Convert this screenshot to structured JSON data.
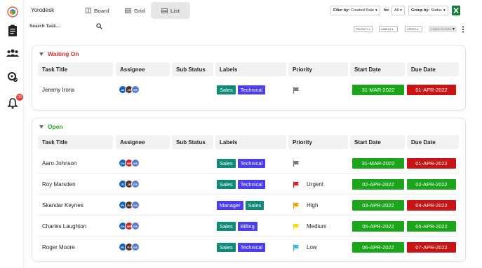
{
  "app": {
    "name": "Yorodesk"
  },
  "views": [
    {
      "label": "Board",
      "icon": "board-icon"
    },
    {
      "label": "Grid",
      "icon": "grid-icon"
    },
    {
      "label": "List",
      "icon": "list-icon",
      "active": true
    }
  ],
  "filters": {
    "filter_by_label": "Filter by:",
    "filter_by_value": "Created Date",
    "for_label": "for",
    "for_value": "All",
    "group_by_label": "Group by:",
    "group_by_value": "Status"
  },
  "search": {
    "placeholder": "Search Task..."
  },
  "quick_filters": {
    "priority": "PRIORITY",
    "labels": "LABELS",
    "users": "USERS",
    "clear": "CLEAR FILTERS"
  },
  "sidebar": {
    "notification_count": "30"
  },
  "columns": [
    "Task Title",
    "Assignee",
    "Sub Status",
    "Labels",
    "Priority",
    "Start Date",
    "Due Date"
  ],
  "colors": {
    "sales": "#0f8a76",
    "technical": "#4b3df0",
    "manager": "#4b3df0",
    "billing": "#4b3df0",
    "date_green": "#1aa51a",
    "date_red": "#c81414",
    "waiting": "#d32f2f",
    "open": "#2e9e2e"
  },
  "groups": [
    {
      "title": "Waiting On",
      "rows": [
        {
          "task": "Jeremy Irons",
          "assignees": [
            "JC",
            "JS",
            "GS"
          ],
          "labels": [
            "Sales",
            "Technical"
          ],
          "priority": "",
          "flag_color": "#777777",
          "start": "31-MAR-2022",
          "due": "01-APR-2022",
          "start_color": "green",
          "due_color": "red"
        }
      ]
    },
    {
      "title": "Open",
      "rows": [
        {
          "task": "Aaro Johnson",
          "assignees": [
            "DA",
            "WE",
            "GS"
          ],
          "labels": [
            "Sales",
            "Technical"
          ],
          "priority": "",
          "flag_color": "#777777",
          "start": "31-MAR-2022",
          "due": "01-APR-2022",
          "start_color": "green",
          "due_color": "red"
        },
        {
          "task": "Roy Marsden",
          "assignees": [
            "JC",
            "JS",
            "GS"
          ],
          "labels": [
            "Sales",
            "Technical"
          ],
          "priority": "Urgent",
          "flag_color": "#e11b1b",
          "start": "02-APR-2022",
          "due": "02-APR-2022",
          "start_color": "green",
          "due_color": "green"
        },
        {
          "task": "Skandar Keynes",
          "assignees": [
            "P1",
            "P2",
            "GS"
          ],
          "labels": [
            "Manager",
            "Sales"
          ],
          "priority": "High",
          "flag_color": "#f59c0b",
          "start": "03-APR-2022",
          "due": "04-APR-2022",
          "start_color": "green",
          "due_color": "red"
        },
        {
          "task": "Charles Laughton",
          "assignees": [
            "DA",
            "WE",
            "GS"
          ],
          "labels": [
            "Sales",
            "Billing"
          ],
          "priority": "Medium",
          "flag_color": "#f2e10a",
          "start": "05-APR-2022",
          "due": "05-APR-2022",
          "start_color": "green",
          "due_color": "green"
        },
        {
          "task": "Roger Moore",
          "assignees": [
            "P1",
            "P2",
            "GS"
          ],
          "labels": [
            "Sales",
            "Technical"
          ],
          "priority": "Low",
          "flag_color": "#2fb4ef",
          "start": "06-APR-2022",
          "due": "07-APR-2022",
          "start_color": "green",
          "due_color": "red"
        }
      ]
    }
  ]
}
